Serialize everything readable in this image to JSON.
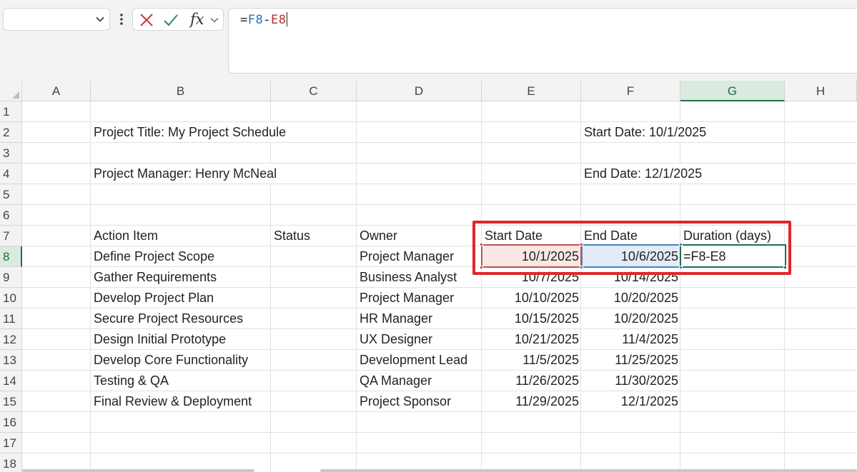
{
  "formula_bar": {
    "name_box_value": "",
    "formula": {
      "eq": "=",
      "ref1": "F8",
      "op": "-",
      "ref2": "E8"
    },
    "icons": [
      "chevron-down-icon",
      "more-icon",
      "cancel-icon",
      "enter-icon",
      "fx-icon"
    ],
    "fx_label": "fx"
  },
  "columns": [
    "A",
    "B",
    "C",
    "D",
    "E",
    "F",
    "G",
    "H"
  ],
  "selected_column": "G",
  "rows": [
    "1",
    "2",
    "3",
    "4",
    "5",
    "6",
    "7",
    "8",
    "9",
    "10",
    "11",
    "12",
    "13",
    "14",
    "15",
    "16",
    "17",
    "18"
  ],
  "selected_row": "8",
  "project": {
    "title": "Project Title: My Project Schedule",
    "manager": "Project Manager: Henry McNeal",
    "start": "Start Date: 10/1/2025",
    "end": "End Date: 12/1/2025"
  },
  "table": {
    "headers": {
      "action": "Action Item",
      "status": "Status",
      "owner": "Owner",
      "start": "Start Date",
      "end": "End Date",
      "duration": "Duration (days)"
    },
    "rows": [
      {
        "action": "Define Project Scope",
        "owner": "Project Manager",
        "start": "10/1/2025",
        "end": "10/6/2025",
        "duration": "=F8-E8"
      },
      {
        "action": "Gather Requirements",
        "owner": "Business Analyst",
        "start": "10/7/2025",
        "end": "10/14/2025",
        "duration": ""
      },
      {
        "action": "Develop Project Plan",
        "owner": "Project Manager",
        "start": "10/10/2025",
        "end": "10/20/2025",
        "duration": ""
      },
      {
        "action": "Secure Project Resources",
        "owner": "HR Manager",
        "start": "10/15/2025",
        "end": "10/20/2025",
        "duration": ""
      },
      {
        "action": "Design Initial Prototype",
        "owner": "UX Designer",
        "start": "10/21/2025",
        "end": "11/4/2025",
        "duration": ""
      },
      {
        "action": "Develop Core Functionality",
        "owner": "Development Lead",
        "start": "11/5/2025",
        "end": "11/25/2025",
        "duration": ""
      },
      {
        "action": "Testing & QA",
        "owner": "QA Manager",
        "start": "11/26/2025",
        "end": "11/30/2025",
        "duration": ""
      },
      {
        "action": "Final Review & Deployment",
        "owner": "Project Sponsor",
        "start": "11/29/2025",
        "end": "12/1/2025",
        "duration": ""
      }
    ]
  },
  "colors": {
    "ref_red": "#c0504d",
    "ref_blue": "#4f81bd",
    "active_green": "#1e7145",
    "callout_red": "#e0262b"
  }
}
